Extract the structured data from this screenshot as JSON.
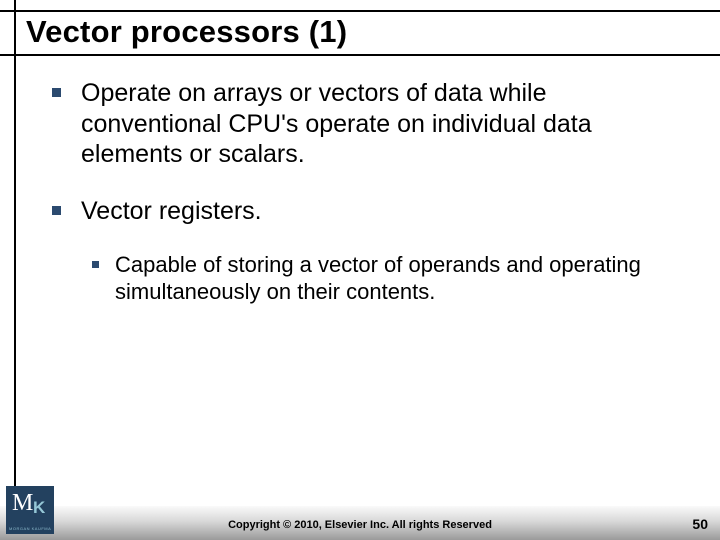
{
  "title": "Vector processors (1)",
  "bullets": [
    {
      "text": "Operate on arrays or vectors of data while conventional CPU's operate on individual data elements or scalars."
    },
    {
      "text": "Vector registers.",
      "sub": [
        {
          "text": "Capable of storing a vector of operands and operating simultaneously on their contents."
        }
      ]
    }
  ],
  "footer": {
    "copyright": "Copyright © 2010, Elsevier Inc. All rights Reserved",
    "page": "50",
    "logo": {
      "m": "M",
      "k": "K",
      "sub": "MORGAN KAUFMANN"
    }
  }
}
